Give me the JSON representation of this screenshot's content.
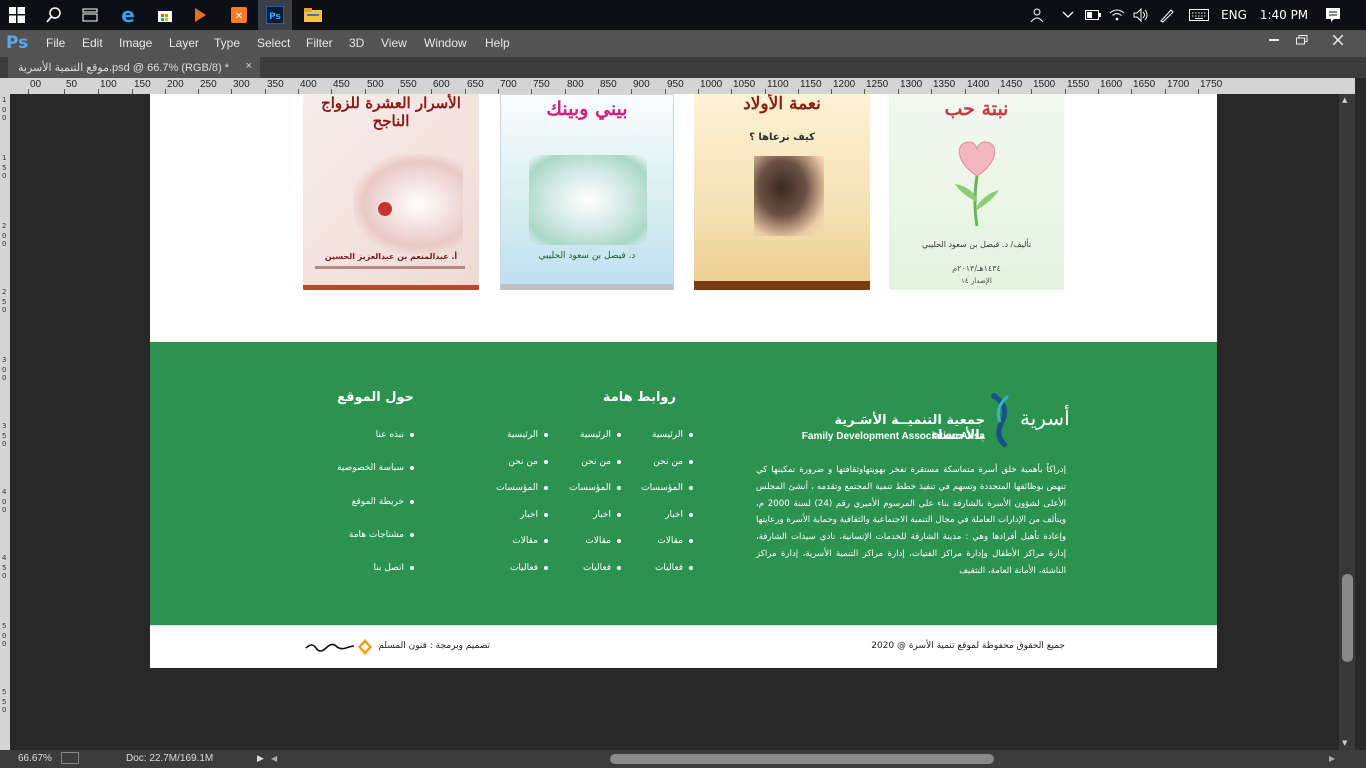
{
  "taskbar": {
    "lang": "ENG",
    "time": "1:40 PM"
  },
  "menu": [
    "File",
    "Edit",
    "Image",
    "Layer",
    "Type",
    "Select",
    "Filter",
    "3D",
    "View",
    "Window",
    "Help"
  ],
  "document": {
    "tab_title": "موقع التنمية الأسرية.psd @ 66.7% (RGB/8) *"
  },
  "ruler": [
    "00",
    "50",
    "100",
    "150",
    "200",
    "250",
    "300",
    "350",
    "400",
    "450",
    "500",
    "550",
    "600",
    "650",
    "700",
    "750",
    "800",
    "850",
    "900",
    "950",
    "1000",
    "1050",
    "1100",
    "1150",
    "1200",
    "1250",
    "1300",
    "1350",
    "1400",
    "1450",
    "1500",
    "1550",
    "1600",
    "1650",
    "1700",
    "1750"
  ],
  "status": {
    "zoom": "66.67%",
    "doc": "Doc: 22.7M/169.1M"
  },
  "books": [
    {
      "title": "الأسرار العشرة للزواج الناجح",
      "author": "أ. عبدالمنعم بن عبدالعزيز الحسين"
    },
    {
      "title": "بيني وبينك",
      "author": "د. فيصل بن سعود الحليبي"
    },
    {
      "title": "نعمة الأولاد",
      "subtitle": "كيف نرعاها ؟"
    },
    {
      "title": "نبتة حب",
      "author": "تأليف/ د. فيصل بن سعود الحليبي",
      "date": "١٤٣٤هـ/٢٠١٣م",
      "edition": "الإصدار ١٤"
    }
  ],
  "footer": {
    "logo_ar": "جمعية التنميــة الأسَـرية بالأحساء",
    "logo_en": "Family Development Association Ahsa",
    "logo_word": "أسرية",
    "about": "إدراكاً بأهمية خلق أسرة متماسكة مستقرة تفخر بهويتهاوثقافتها و ضرورة تمكينها كي تنهض بوظائفها المتجددة وتسهم في تنفيذ خطط تنمية المجتمع وتقدمه ، أنشئ المجلس الأعلى لشؤون الأسرة بالشارقة بناء على المرسوم الأميري رقم (24) لسنة 2000 م، ويتألف من الإدارات العاملة في مجال التنمية الاجتماعية والثقافية وحماية الأسرة ورعايتها وإعادة تأهيل أفرادها وهي : مدينة الشارقة للخدمات الإنسانية، نادي سيدات الشارقة، إدارة مراكز الأطفال وإدارة مراكز الفتيات، إدارة مراكز التنمية الأسرية، إدارة مراكز الناشئة، الأمانة العامة، التثقيف",
    "links_title": "روابط هامة",
    "links_col1": [
      "الرئيسية",
      "من نحن",
      "المؤسسات",
      "اخبار",
      "مقالات",
      "فعاليات"
    ],
    "links_col2": [
      "الرئيسية",
      "من نحن",
      "المؤسسات",
      "اخبار",
      "مقالات",
      "فعاليات"
    ],
    "links_col3": [
      "الرئيسية",
      "من نحن",
      "المؤسسات",
      "اخبار",
      "مقالات",
      "فعاليات"
    ],
    "about_title": "حول الموقع",
    "about_links": [
      "نبذه عنا",
      "سياسة الخصوصية",
      "خريطة الموقع",
      "مشتاجات هامة",
      "اتصل بنا"
    ]
  },
  "bottom": {
    "copyright": "جميع الحقوق محفوظة لموقع تنمية الأسرة @ 2020",
    "design": "تصميم وبرمجة : فنون المسلم"
  },
  "colors": {
    "footer_green": "#2b9250",
    "ps_blue": "#59a8e8"
  }
}
